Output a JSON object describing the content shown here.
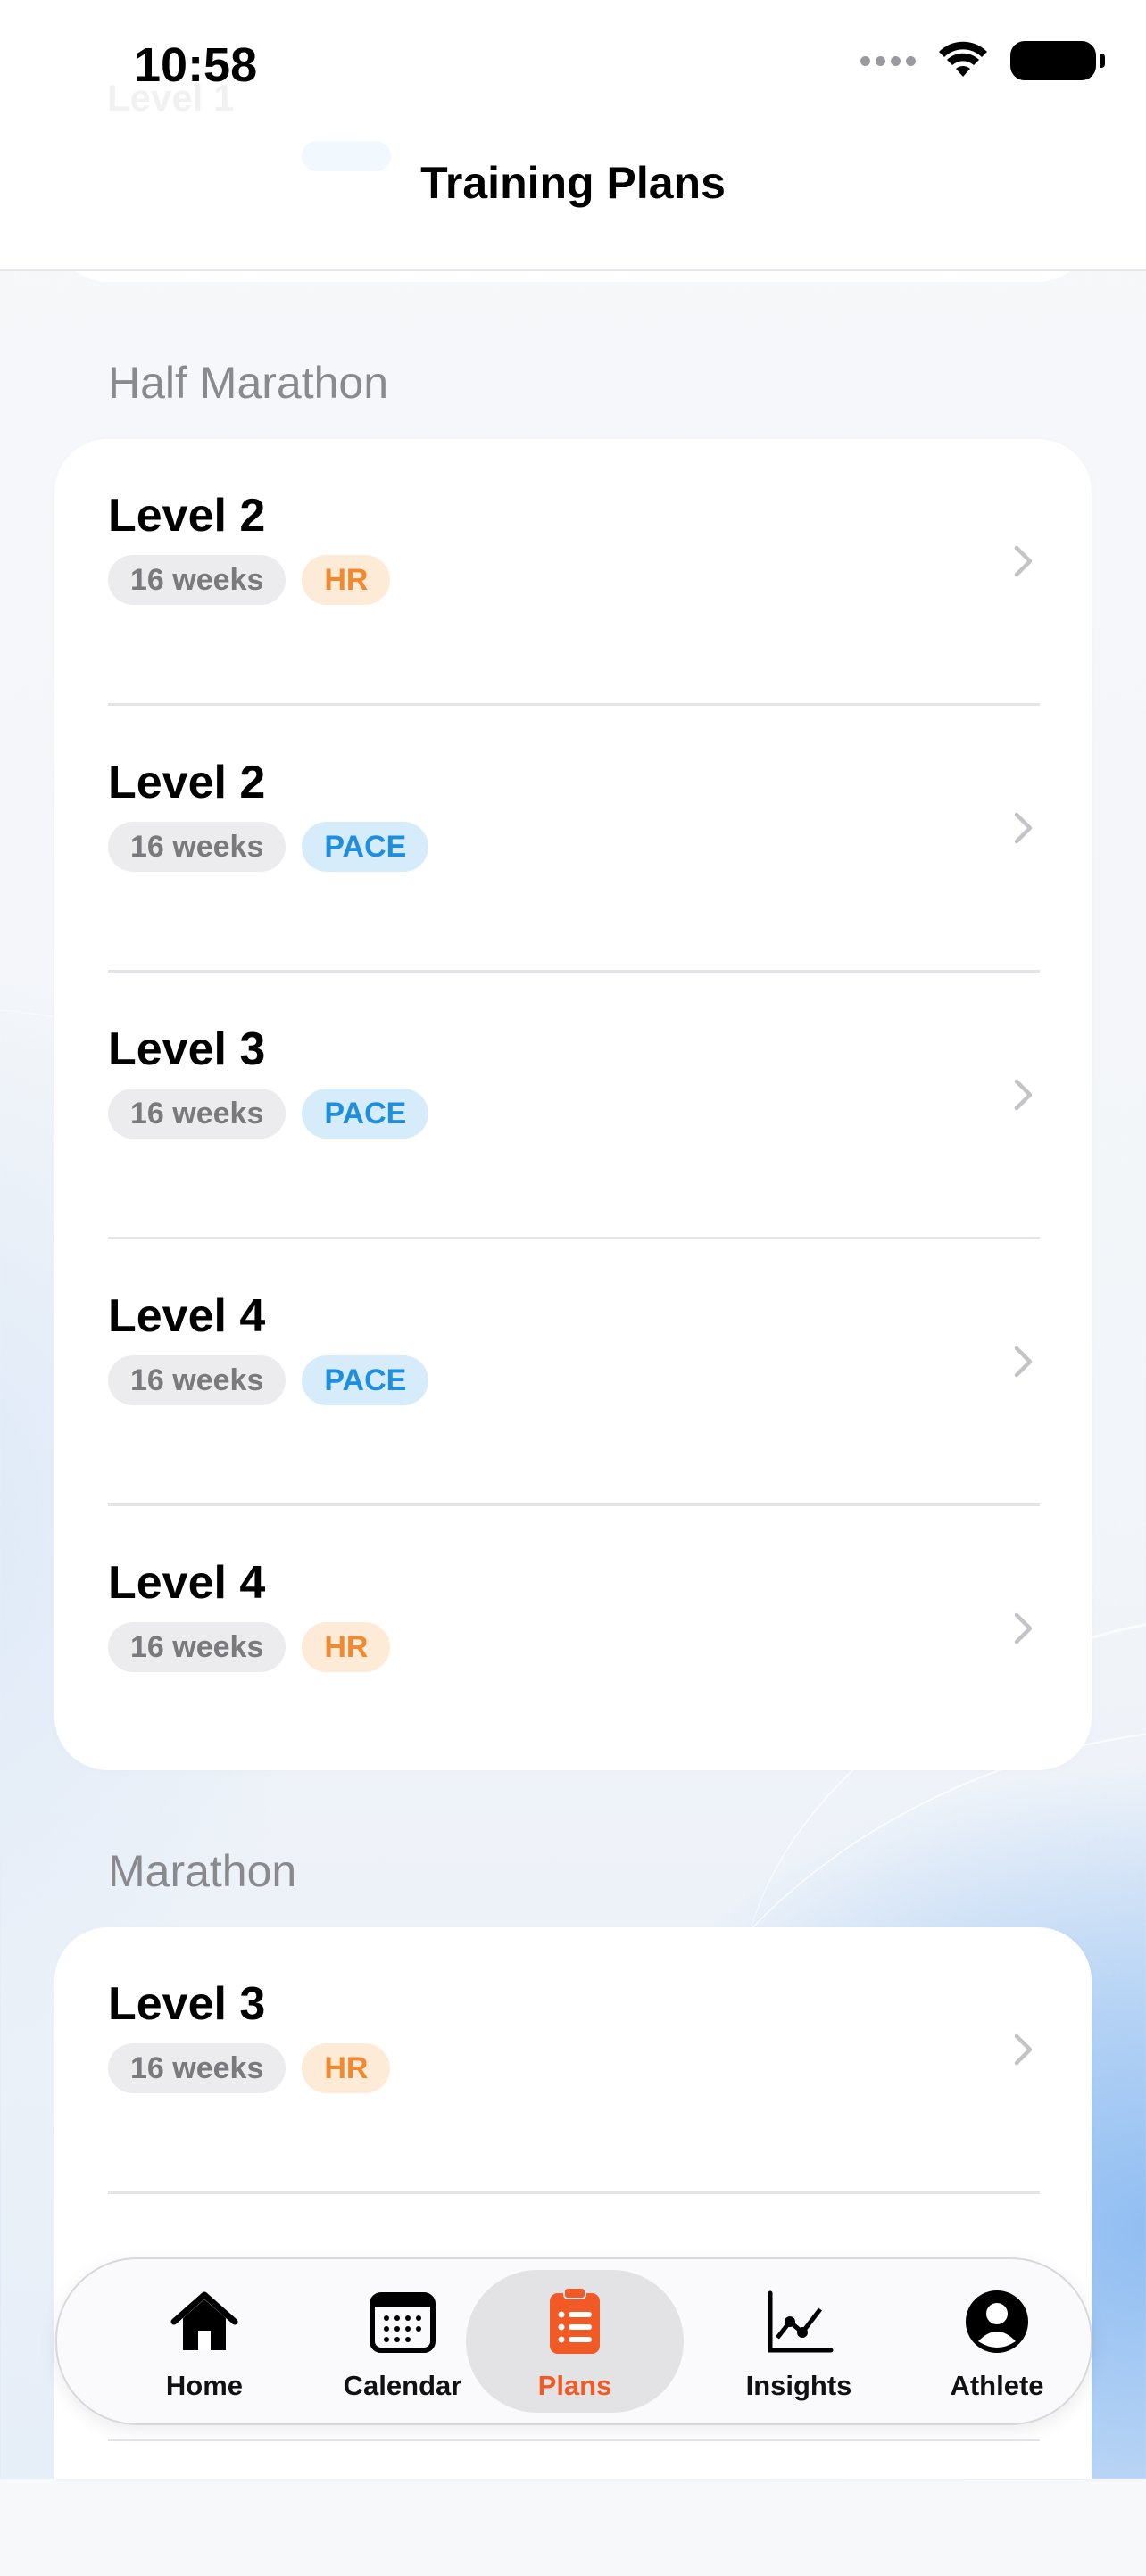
{
  "status_bar": {
    "time": "10:58"
  },
  "nav": {
    "title": "Training Plans"
  },
  "sections": [
    {
      "title": "Half Marathon",
      "plans": [
        {
          "level": "Level 2",
          "duration": "16 weeks",
          "type": "HR"
        },
        {
          "level": "Level 2",
          "duration": "16 weeks",
          "type": "PACE"
        },
        {
          "level": "Level 3",
          "duration": "16 weeks",
          "type": "PACE"
        },
        {
          "level": "Level 4",
          "duration": "16 weeks",
          "type": "PACE"
        },
        {
          "level": "Level 4",
          "duration": "16 weeks",
          "type": "HR"
        }
      ]
    },
    {
      "title": "Marathon",
      "plans": [
        {
          "level": "Level 3",
          "duration": "16 weeks",
          "type": "HR"
        }
      ]
    }
  ],
  "tabs": [
    {
      "label": "Home",
      "icon": "house-icon"
    },
    {
      "label": "Calendar",
      "icon": "calendar-icon"
    },
    {
      "label": "Plans",
      "icon": "clipboard-list-icon",
      "active": true
    },
    {
      "label": "Insights",
      "icon": "chart-line-icon"
    },
    {
      "label": "Athlete",
      "icon": "person-circle-icon"
    }
  ],
  "colors": {
    "accent": "#f15a24",
    "hr_tag": "#f0892f",
    "pace_tag": "#1e8fe0"
  }
}
